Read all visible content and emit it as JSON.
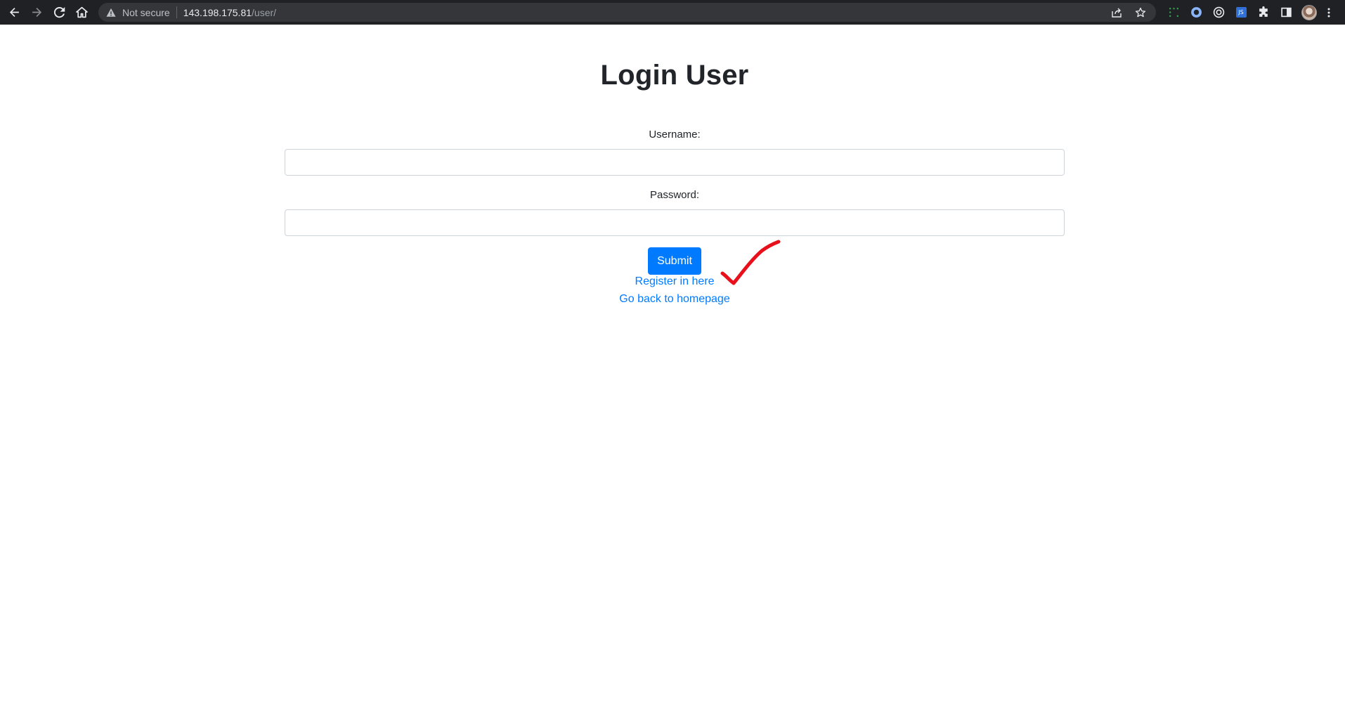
{
  "browser": {
    "security_label": "Not secure",
    "url_host": "143.198.175.81",
    "url_path": "/user/"
  },
  "page": {
    "title": "Login User",
    "form": {
      "username_label": "Username:",
      "username_value": "",
      "password_label": "Password:",
      "password_value": "",
      "submit_label": "Submit"
    },
    "links": {
      "register": "Register in here",
      "home": "Go back to homepage"
    }
  },
  "colors": {
    "primary": "#007bff",
    "annotation": "#e8101a",
    "chrome_bg": "#202124"
  },
  "icons": {
    "annotation": "red-checkmark-annotation"
  }
}
